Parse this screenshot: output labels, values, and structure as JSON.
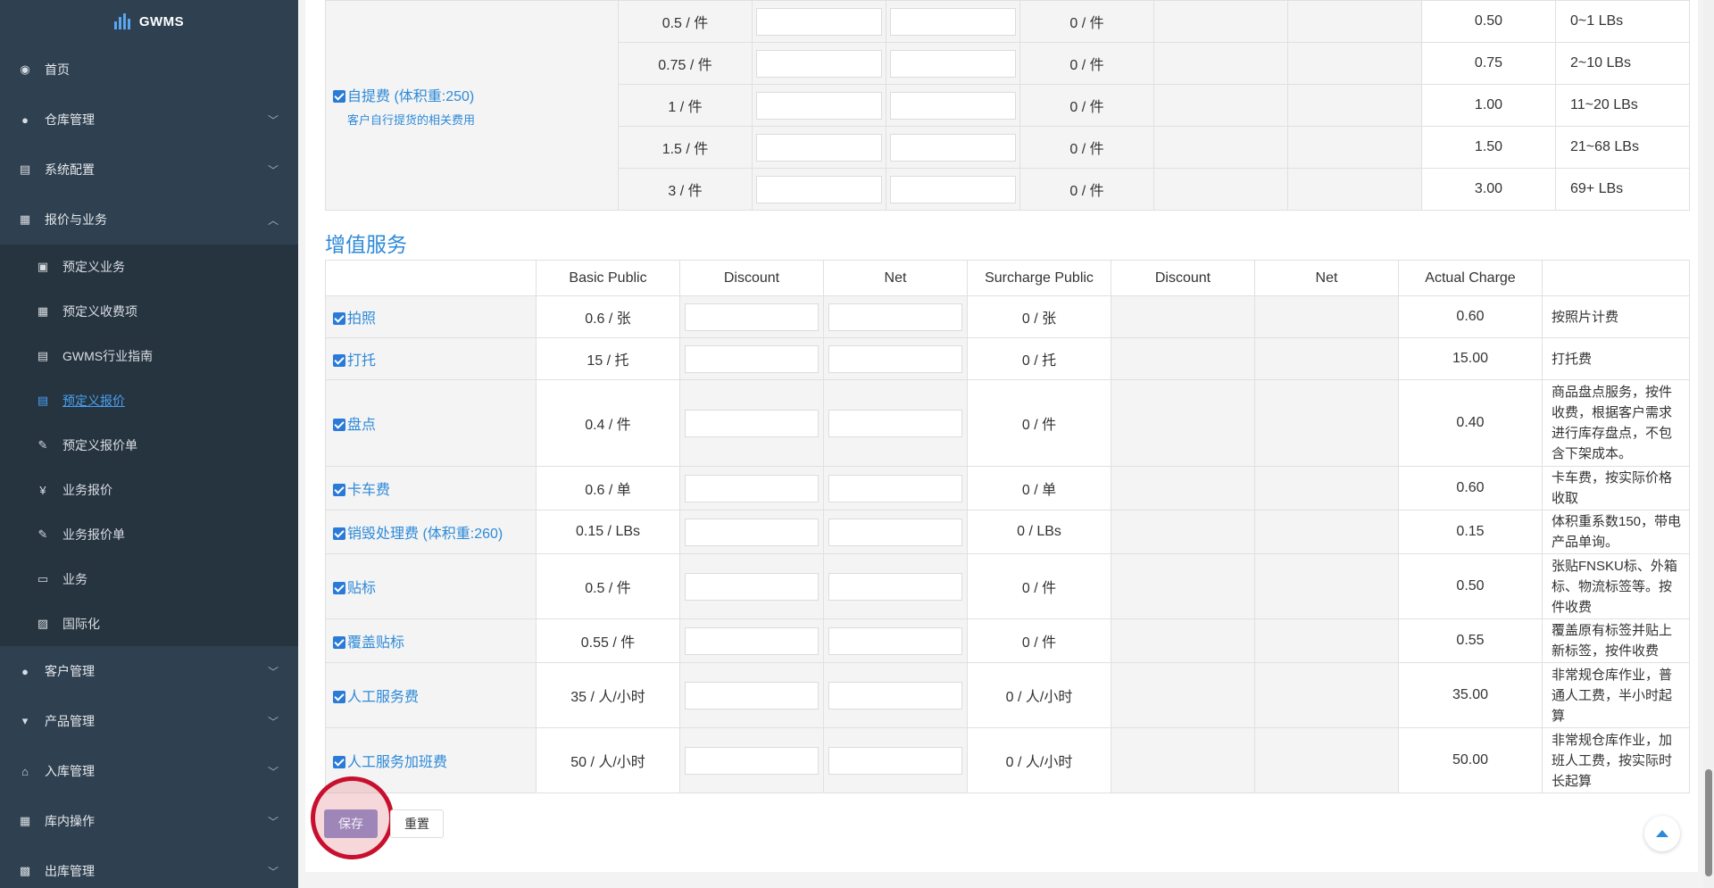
{
  "app": {
    "logo": "GWMS"
  },
  "sidebar": {
    "items": [
      {
        "label": "首页",
        "icon": "dashboard-icon"
      },
      {
        "label": "仓库管理",
        "icon": "globe-icon"
      },
      {
        "label": "系统配置",
        "icon": "server-icon"
      },
      {
        "label": "报价与业务",
        "icon": "ledger-icon"
      },
      {
        "label": "客户管理",
        "icon": "user-icon"
      },
      {
        "label": "产品管理",
        "icon": "cart-icon"
      },
      {
        "label": "入库管理",
        "icon": "home-icon"
      },
      {
        "label": "库内操作",
        "icon": "table-icon"
      },
      {
        "label": "出库管理",
        "icon": "grid-icon"
      }
    ],
    "sub_items": [
      {
        "label": "预定义业务"
      },
      {
        "label": "预定义收费项"
      },
      {
        "label": "GWMS行业指南"
      },
      {
        "label": "预定义报价"
      },
      {
        "label": "预定义报价单"
      },
      {
        "label": "业务报价",
        "icon_glyph": "¥"
      },
      {
        "label": "业务报价单"
      },
      {
        "label": "业务"
      },
      {
        "label": "国际化"
      }
    ]
  },
  "pickup": {
    "name": "自提费 (体积重:250)",
    "description": "客户自行提货的相关费用",
    "rows": [
      {
        "basic": "0.5 / 件",
        "surcharge": "0 / 件",
        "actual": "0.50",
        "label": "0~1 LBs"
      },
      {
        "basic": "0.75 / 件",
        "surcharge": "0 / 件",
        "actual": "0.75",
        "label": "2~10 LBs"
      },
      {
        "basic": "1 / 件",
        "surcharge": "0 / 件",
        "actual": "1.00",
        "label": "11~20 LBs"
      },
      {
        "basic": "1.5 / 件",
        "surcharge": "0 / 件",
        "actual": "1.50",
        "label": "21~68 LBs"
      },
      {
        "basic": "3 / 件",
        "surcharge": "0 / 件",
        "actual": "3.00",
        "label": "69+ LBs"
      }
    ]
  },
  "value_added": {
    "title": "增值服务",
    "headers": [
      "",
      "Basic Public",
      "Discount",
      "Net",
      "Surcharge Public",
      "Discount",
      "Net",
      "Actual Charge",
      ""
    ],
    "rows": [
      {
        "name": "拍照",
        "basic": "0.6 / 张",
        "surcharge": "0 / 张",
        "actual": "0.60",
        "desc": "按照片计费"
      },
      {
        "name": "打托",
        "basic": "15 / 托",
        "surcharge": "0 / 托",
        "actual": "15.00",
        "desc": "打托费"
      },
      {
        "name": "盘点",
        "basic": "0.4 / 件",
        "surcharge": "0 / 件",
        "actual": "0.40",
        "desc": "商品盘点服务，按件收费，根据客户需求进行库存盘点，不包含下架成本。"
      },
      {
        "name": "卡车费",
        "basic": "0.6 / 单",
        "surcharge": "0 / 单",
        "actual": "0.60",
        "desc": "卡车费，按实际价格收取"
      },
      {
        "name": "销毁处理费 (体积重:260)",
        "basic": "0.15 / LBs",
        "surcharge": "0 / LBs",
        "actual": "0.15",
        "desc": "体积重系数150，带电产品单询。"
      },
      {
        "name": "贴标",
        "basic": "0.5 / 件",
        "surcharge": "0 / 件",
        "actual": "0.50",
        "desc": "张贴FNSKU标、外箱标、物流标签等。按件收费"
      },
      {
        "name": "覆盖贴标",
        "basic": "0.55 / 件",
        "surcharge": "0 / 件",
        "actual": "0.55",
        "desc": "覆盖原有标签并贴上新标签，按件收费"
      },
      {
        "name": "人工服务费",
        "basic": "35 / 人/小时",
        "surcharge": "0 / 人/小时",
        "actual": "35.00",
        "desc": "非常规仓库作业，普通人工费，半小时起算"
      },
      {
        "name": "人工服务加班费",
        "basic": "50 / 人/小时",
        "surcharge": "0 / 人/小时",
        "actual": "50.00",
        "desc": "非常规仓库作业，加班人工费，按实际时长起算"
      }
    ]
  },
  "actions": {
    "save": "保存",
    "reset": "重置"
  }
}
